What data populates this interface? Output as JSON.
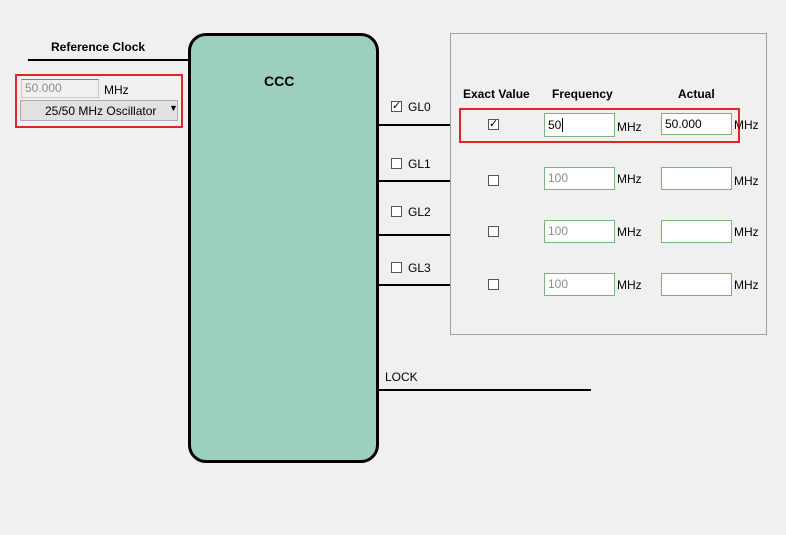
{
  "reference_clock": {
    "title": "Reference Clock",
    "frequency_value": "50.000",
    "frequency_unit": "MHz",
    "source_select": "25/50 MHz Oscillator"
  },
  "ccc": {
    "title": "CCC",
    "color": "#9ccfbc"
  },
  "outputs": [
    {
      "label": "GL0",
      "checked": true
    },
    {
      "label": "GL1",
      "checked": false
    },
    {
      "label": "GL2",
      "checked": false
    },
    {
      "label": "GL3",
      "checked": false
    }
  ],
  "lock_label": "LOCK",
  "settings": {
    "headers": {
      "exact_value": "Exact Value",
      "frequency": "Frequency",
      "actual": "Actual"
    },
    "rows": [
      {
        "exact_checked": true,
        "frequency": "50",
        "frequency_unit": "MHz",
        "actual": "50.000",
        "actual_unit": "MHz"
      },
      {
        "exact_checked": false,
        "frequency": "100",
        "frequency_unit": "MHz",
        "actual": "",
        "actual_unit": "MHz"
      },
      {
        "exact_checked": false,
        "frequency": "100",
        "frequency_unit": "MHz",
        "actual": "",
        "actual_unit": "MHz"
      },
      {
        "exact_checked": false,
        "frequency": "100",
        "frequency_unit": "MHz",
        "actual": "",
        "actual_unit": "MHz"
      }
    ]
  },
  "highlight_color": "#e0262b"
}
